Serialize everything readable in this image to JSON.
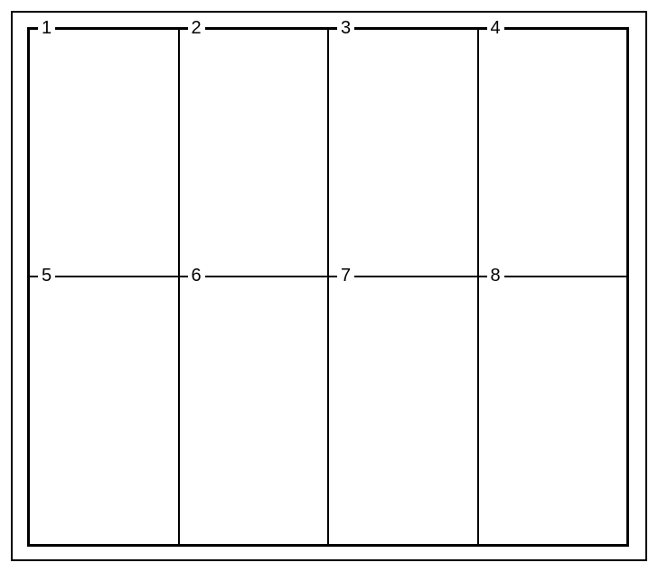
{
  "grid": {
    "cells": [
      {
        "label": "1"
      },
      {
        "label": "2"
      },
      {
        "label": "3"
      },
      {
        "label": "4"
      },
      {
        "label": "5"
      },
      {
        "label": "6"
      },
      {
        "label": "7"
      },
      {
        "label": "8"
      }
    ]
  }
}
